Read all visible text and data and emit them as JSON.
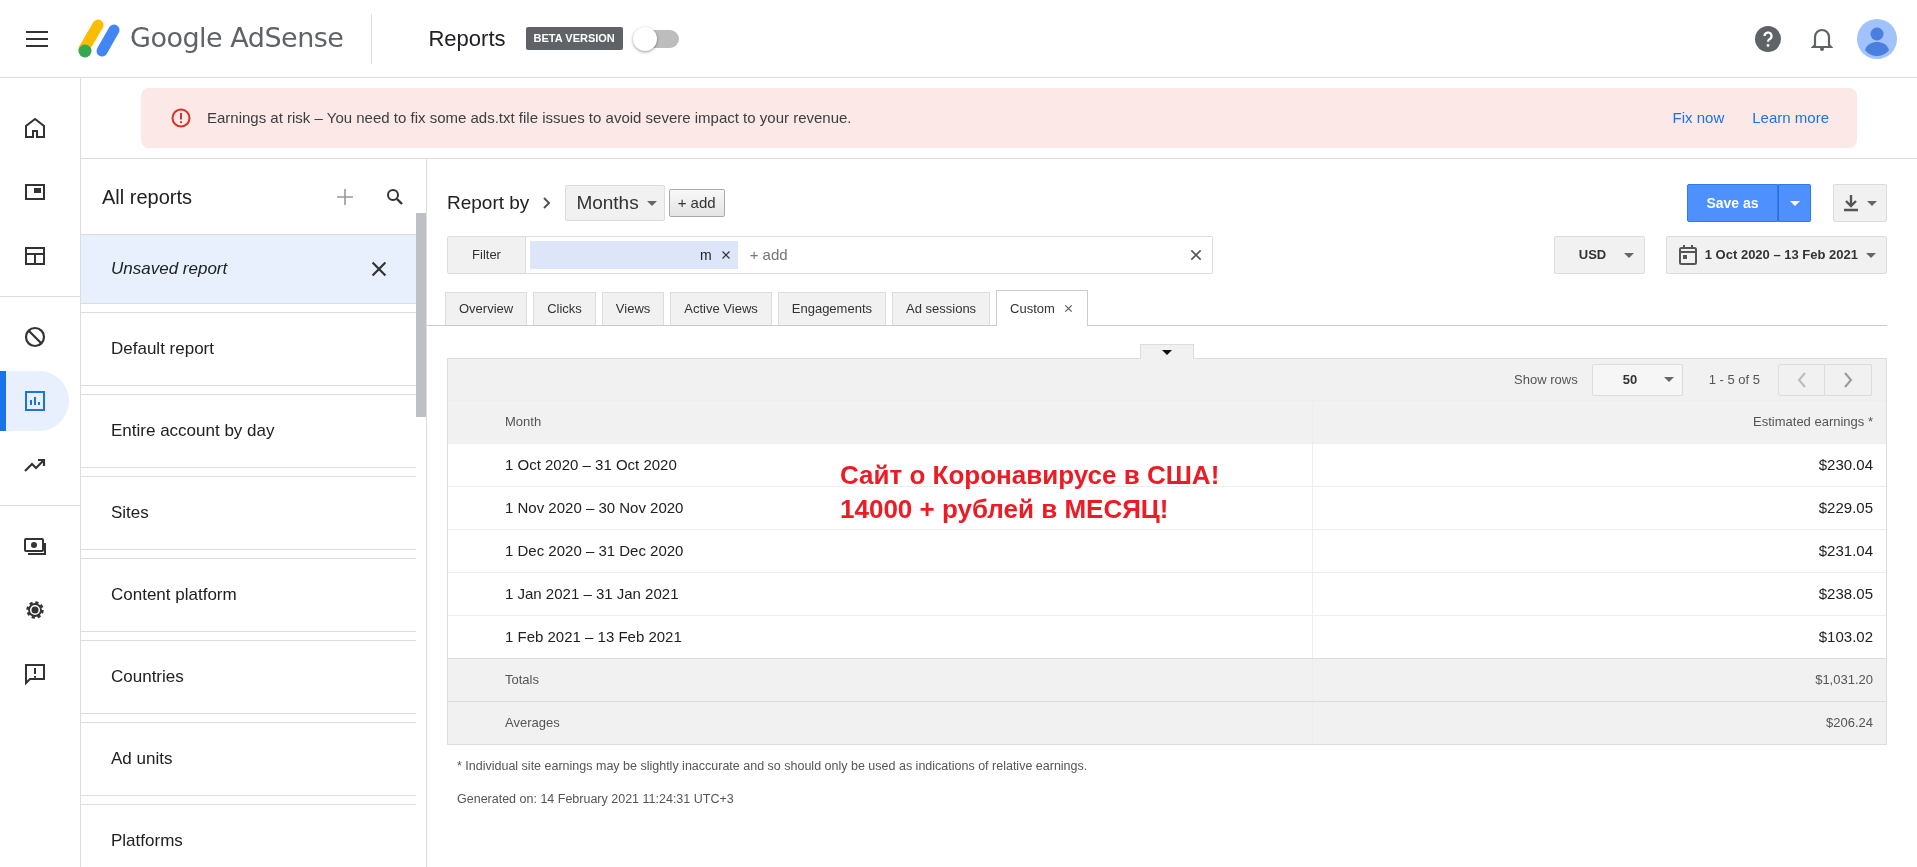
{
  "header": {
    "product": "Google AdSense",
    "page_title": "Reports",
    "badge": "BETA VERSION",
    "beta_toggle": {
      "on": false
    }
  },
  "rail_groups": [
    [
      {
        "kind": "home",
        "selected": false
      },
      {
        "kind": "ads",
        "selected": false
      },
      {
        "kind": "sites",
        "selected": false
      }
    ],
    [
      {
        "kind": "block",
        "selected": false
      },
      {
        "kind": "reports",
        "selected": true
      },
      {
        "kind": "trend",
        "selected": false
      }
    ],
    [
      {
        "kind": "payments",
        "selected": false
      },
      {
        "kind": "settings",
        "selected": false
      },
      {
        "kind": "feedback",
        "selected": false
      }
    ]
  ],
  "alert": {
    "message": "Earnings at risk – You need to fix some ads.txt file issues to avoid severe impact to your revenue.",
    "links": [
      "Fix now",
      "Learn more"
    ]
  },
  "reports_panel": {
    "title": "All reports",
    "items": [
      {
        "label": "Unsaved report",
        "kind": "unsaved",
        "selected": true
      },
      {
        "label": "Default report",
        "kind": "saved",
        "selected": false
      },
      {
        "label": "Entire account by day",
        "kind": "saved",
        "selected": false
      },
      {
        "label": "Sites",
        "kind": "saved",
        "selected": false
      },
      {
        "label": "Content platform",
        "kind": "saved",
        "selected": false
      },
      {
        "label": "Countries",
        "kind": "saved",
        "selected": false
      },
      {
        "label": "Ad units",
        "kind": "saved",
        "selected": false
      },
      {
        "label": "Platforms",
        "kind": "saved",
        "selected": false
      }
    ]
  },
  "report_by": {
    "label": "Report by",
    "dimension": "Months",
    "add": "+ add"
  },
  "save_button": "Save as",
  "filter": {
    "label": "Filter",
    "chip": "m",
    "placeholder": "+ add"
  },
  "currency": "USD",
  "date_range": "1 Oct 2020 – 13 Feb 2021",
  "tabs": [
    {
      "label": "Overview",
      "selected": false,
      "closable": false
    },
    {
      "label": "Clicks",
      "selected": false,
      "closable": false
    },
    {
      "label": "Views",
      "selected": false,
      "closable": false
    },
    {
      "label": "Active Views",
      "selected": false,
      "closable": false
    },
    {
      "label": "Engagements",
      "selected": false,
      "closable": false
    },
    {
      "label": "Ad sessions",
      "selected": false,
      "closable": false
    },
    {
      "label": "Custom",
      "selected": true,
      "closable": true
    }
  ],
  "table": {
    "show_rows_label": "Show rows",
    "rows_per_page": "50",
    "range": "1 - 5 of 5",
    "columns": [
      "Month",
      "Estimated earnings *"
    ],
    "rows": [
      [
        "1 Oct 2020 – 31 Oct 2020",
        "$230.04"
      ],
      [
        "1 Nov 2020 – 30 Nov 2020",
        "$229.05"
      ],
      [
        "1 Dec 2020 – 31 Dec 2020",
        "$231.04"
      ],
      [
        "1 Jan 2021 – 31 Jan 2021",
        "$238.05"
      ],
      [
        "1 Feb 2021 – 13 Feb 2021",
        "$103.02"
      ]
    ],
    "summary": [
      [
        "Totals",
        "$1,031.20"
      ],
      [
        "Averages",
        "$206.24"
      ]
    ]
  },
  "footnote": "* Individual site earnings may be slightly inaccurate and so should only be used as indications of relative earnings.",
  "generated": "Generated on: 14 February 2021 11:24:31 UTC+3",
  "annotation": [
    "Сайт о Коронавирусе в США!",
    "14000 + рублей в МЕСЯЦ!"
  ]
}
